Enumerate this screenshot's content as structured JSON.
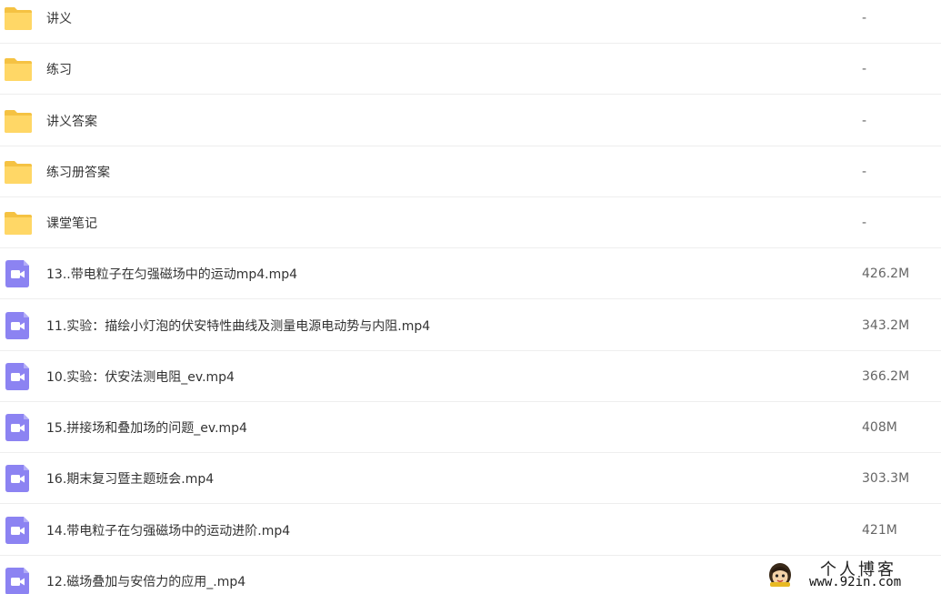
{
  "files": [
    {
      "icon": "folder-icon",
      "name": "讲义",
      "size": "-"
    },
    {
      "icon": "folder-icon",
      "name": "练习",
      "size": "-"
    },
    {
      "icon": "folder-icon",
      "name": "讲义答案",
      "size": "-"
    },
    {
      "icon": "folder-icon",
      "name": "练习册答案",
      "size": "-"
    },
    {
      "icon": "folder-icon",
      "name": "课堂笔记",
      "size": "-"
    },
    {
      "icon": "video-file-icon",
      "name": "13..带电粒子在匀强磁场中的运动mp4.mp4",
      "size": "426.2M"
    },
    {
      "icon": "video-file-icon",
      "name": "11.实验：描绘小灯泡的伏安特性曲线及测量电源电动势与内阻.mp4",
      "size": "343.2M"
    },
    {
      "icon": "video-file-icon",
      "name": "10.实验：伏安法测电阻_ev.mp4",
      "size": "366.2M"
    },
    {
      "icon": "video-file-icon",
      "name": "15.拼接场和叠加场的问题_ev.mp4",
      "size": "408M"
    },
    {
      "icon": "video-file-icon",
      "name": "16.期末复习暨主题班会.mp4",
      "size": "303.3M"
    },
    {
      "icon": "video-file-icon",
      "name": "14.带电粒子在匀强磁场中的运动进阶.mp4",
      "size": "421M"
    },
    {
      "icon": "video-file-icon",
      "name": "12.磁场叠加与安倍力的应用_.mp4",
      "size": ""
    }
  ],
  "colors": {
    "folder": "#ffd766",
    "folder_tab": "#f5c242",
    "video": "#8c83f2"
  },
  "watermark": {
    "title": "个人博客",
    "url": "www.92in.com",
    "icon": "avatar-logo-icon"
  }
}
